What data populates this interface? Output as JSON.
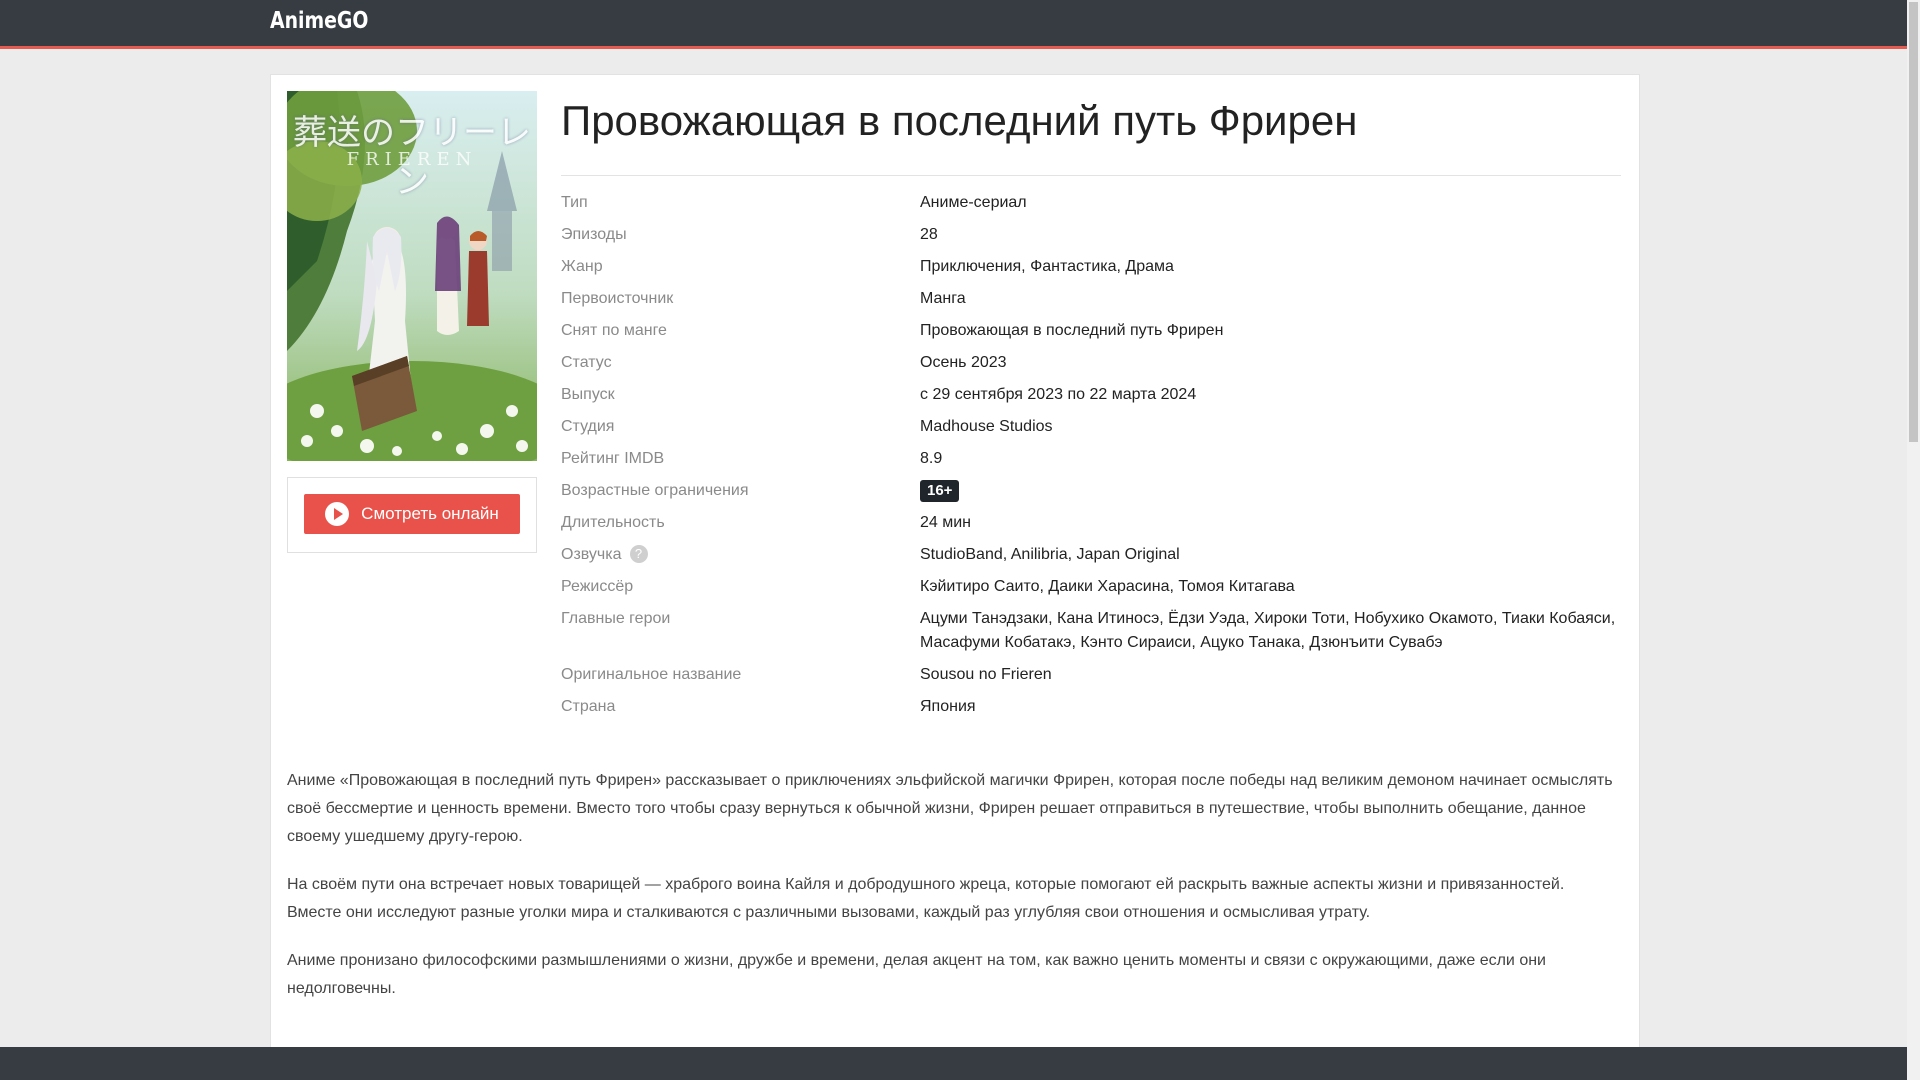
{
  "header": {
    "logo": "AnimeGO"
  },
  "anime": {
    "title": "Провожающая в последний путь Фрирен",
    "poster": {
      "title_jp": "葬送のフリーレン",
      "title_en": "FRIEREN"
    },
    "watch_label": "Смотреть онлайн",
    "info": [
      {
        "label": "Тип",
        "value": "Аниме-сериал"
      },
      {
        "label": "Эпизоды",
        "value": "28"
      },
      {
        "label": "Жанр",
        "value": "Приключения, Фантастика, Драма"
      },
      {
        "label": "Первоисточник",
        "value": "Манга"
      },
      {
        "label": "Снят по манге",
        "value": "Провожающая в последний путь Фрирен"
      },
      {
        "label": "Статус",
        "value": "Осень 2023"
      },
      {
        "label": "Выпуск",
        "value": "с 29 сентября 2023 по 22 марта 2024"
      },
      {
        "label": "Студия",
        "value": "Madhouse Studios"
      },
      {
        "label": "Рейтинг IMDB",
        "value": "8.9"
      },
      {
        "label": "Возрастные ограничения",
        "value": "16+"
      },
      {
        "label": "Длительность",
        "value": "24 мин"
      },
      {
        "label": "Озвучка",
        "value": "StudioBand, Anilibria, Japan Original",
        "help": "?"
      },
      {
        "label": "Режиссёр",
        "value": "Кэйитиро Саито, Даики Харасина, Томоя Китагава"
      },
      {
        "label": "Главные герои",
        "value": "Ацуми Танэдзаки, Кана Итиносэ, Ёдзи Уэда, Хироки Тоти, Нобухико Окамото, Тиаки Кобаяси, Масафуми Кобатакэ, Кэнто Сираиси, Ацуко Танака, Дзюнъити Сувабэ"
      },
      {
        "label": "Оригинальное название",
        "value": "Sousou no Frieren"
      },
      {
        "label": "Страна",
        "value": "Япония"
      }
    ],
    "description": [
      "Аниме «Провожающая в последний путь Фрирен» рассказывает о приключениях эльфийской магички Фрирен, которая после победы над великим демоном начинает осмыслять своё бессмертие и ценность времени. Вместо того чтобы сразу вернуться к обычной жизни, Фрирен решает отправиться в путешествие, чтобы выполнить обещание, данное своему ушедшему другу-герою.",
      "На своём пути она встречает новых товарищей — храброго воина Кайля и добродушного жреца, которые помогают ей раскрыть важные аспекты жизни и привязанностей. Вместе они исследуют разные уголки мира и сталкиваются с различными вызовами, каждый раз углубляя свои отношения и осмысливая утрату.",
      "Аниме пронизано философскими размышлениями о жизни, дружбе и времени, делая акцент на том, как важно ценить моменты и связи с окружающими, даже если они недолговечны."
    ]
  },
  "colors": {
    "header_bg": "#363c42",
    "accent": "#e9524a",
    "page_bg": "#ececec",
    "label": "#8a8a8a"
  }
}
